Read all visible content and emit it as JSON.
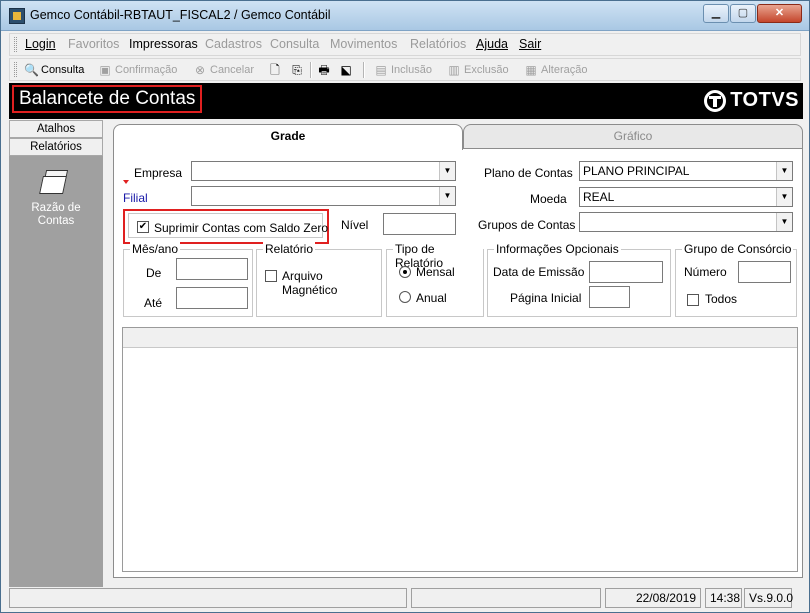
{
  "window": {
    "title": "Gemco Contábil-RBTAUT_FISCAL2 / Gemco Contábil"
  },
  "menu": [
    {
      "label": "Login",
      "enabled": true
    },
    {
      "label": "Favoritos",
      "enabled": false
    },
    {
      "label": "Impressoras",
      "enabled": true
    },
    {
      "label": "Cadastros",
      "enabled": false
    },
    {
      "label": "Consulta",
      "enabled": false
    },
    {
      "label": "Movimentos",
      "enabled": false
    },
    {
      "label": "Relatórios",
      "enabled": false
    },
    {
      "label": "Ajuda",
      "enabled": true
    },
    {
      "label": "Sair",
      "enabled": true
    }
  ],
  "toolbar": {
    "consulta": "Consulta",
    "confirmacao": "Confirmação",
    "cancelar": "Cancelar",
    "inclusao": "Inclusão",
    "exclusao": "Exclusão",
    "alteracao": "Alteração"
  },
  "header": {
    "title": "Balancete de Contas",
    "brand": "TOTVS"
  },
  "left_panel": {
    "btn_atalhos": "Atalhos",
    "btn_relatorios": "Relatórios",
    "item_line1": "Razão de",
    "item_line2": "Contas"
  },
  "tabs": {
    "grade": "Grade",
    "grafico": "Gráfico"
  },
  "form": {
    "empresa_label": "Empresa",
    "empresa_value": "",
    "filial_label": "Filial",
    "filial_value": "",
    "plano_label": "Plano de Contas",
    "plano_value": "PLANO PRINCIPAL",
    "moeda_label": "Moeda",
    "moeda_value": "REAL",
    "suprimir_label": "Suprimir Contas com Saldo Zero",
    "suprimir_checked": true,
    "nivel_label": "Nível",
    "grupos_label": "Grupos de Contas",
    "mesano_title": "Mês/ano",
    "de_label": "De",
    "ate_label": "Até",
    "relatorio_title": "Relatório",
    "arquivo_label": "Arquivo Magnético",
    "tipo_title": "Tipo de Relatório",
    "mensal_label": "Mensal",
    "anual_label": "Anual",
    "tipo_selected": "Mensal",
    "info_title": "Informações Opcionais",
    "data_emissao_label": "Data de Emissão",
    "pagina_inicial_label": "Página Inicial",
    "consorcio_title": "Grupo de Consórcio",
    "numero_label": "Número",
    "todos_label": "Todos"
  },
  "status": {
    "date": "22/08/2019",
    "time": "14:38",
    "version": "Vs.9.0.0"
  },
  "colors": {
    "header_bg": "#000000",
    "highlight": "#e02020",
    "left_panel": "#a0a0a0"
  },
  "icons": [
    "app-icon",
    "consulta-icon",
    "save-icon",
    "cancel-icon",
    "new-document-icon",
    "copy-icon",
    "print-icon",
    "export-icon",
    "inclusao-icon",
    "exclusao-icon",
    "alteracao-icon",
    "report-stack-icon",
    "totvs-logo"
  ]
}
